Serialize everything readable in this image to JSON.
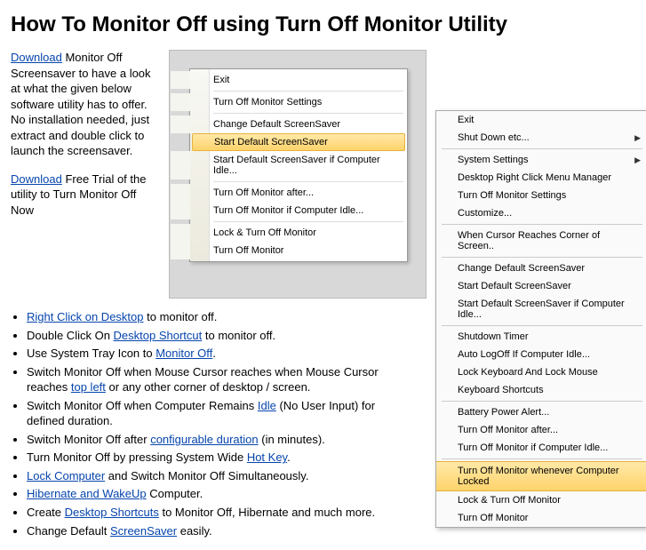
{
  "title": "How To Monitor Off using Turn Off Monitor Utility",
  "intro": {
    "link1": "Download",
    "p1": " Monitor Off Screensaver to have a look at what the given below software utility has to offer. No installation needed, just extract and double click to launch the screensaver.",
    "link2": "Download",
    "p2": " Free Trial of the utility to Turn Monitor Off Now"
  },
  "menu1": [
    {
      "label": "Exit"
    },
    {
      "sep": true
    },
    {
      "label": "Turn Off Monitor Settings"
    },
    {
      "sep": true
    },
    {
      "label": "Change Default ScreenSaver"
    },
    {
      "label": "Start Default ScreenSaver",
      "hl": true
    },
    {
      "label": "Start Default ScreenSaver if Computer Idle..."
    },
    {
      "sep": true
    },
    {
      "label": "Turn Off Monitor after..."
    },
    {
      "label": "Turn Off Monitor if Computer Idle..."
    },
    {
      "sep": true
    },
    {
      "label": "Lock & Turn Off Monitor"
    },
    {
      "label": "Turn Off Monitor"
    }
  ],
  "menu2": [
    {
      "label": "Exit"
    },
    {
      "label": "Shut Down etc...",
      "sub": true
    },
    {
      "sep": true
    },
    {
      "label": "System Settings",
      "sub": true
    },
    {
      "label": "Desktop Right Click Menu Manager"
    },
    {
      "label": "Turn Off Monitor Settings"
    },
    {
      "label": "Customize..."
    },
    {
      "sep": true
    },
    {
      "label": "When Cursor Reaches Corner of Screen.."
    },
    {
      "sep": true
    },
    {
      "label": "Change Default ScreenSaver"
    },
    {
      "label": "Start Default ScreenSaver"
    },
    {
      "label": "Start Default ScreenSaver if Computer Idle..."
    },
    {
      "sep": true
    },
    {
      "label": "Shutdown Timer"
    },
    {
      "label": "Auto LogOff If Computer Idle..."
    },
    {
      "label": "Lock Keyboard And Lock Mouse"
    },
    {
      "label": "Keyboard Shortcuts"
    },
    {
      "sep": true
    },
    {
      "label": "Battery Power Alert..."
    },
    {
      "label": "Turn Off Monitor after..."
    },
    {
      "label": "Turn Off Monitor if Computer Idle..."
    },
    {
      "sep": true
    },
    {
      "label": "Turn Off Monitor whenever Computer Locked",
      "hl": true
    },
    {
      "label": "Lock & Turn Off Monitor"
    },
    {
      "label": "Turn Off Monitor"
    }
  ],
  "bullets": {
    "b1a": "Right Click on Desktop",
    "b1b": " to monitor off.",
    "b2a": "Double Click On ",
    "b2b": "Desktop Shortcut",
    "b2c": " to monitor off.",
    "b3a": "Use System Tray Icon to ",
    "b3b": "Monitor Off",
    "b3c": ".",
    "b4a": "Switch Monitor Off when Mouse Cursor reaches when Mouse Cursor reaches ",
    "b4b": "top left",
    "b4c": " or any other corner of desktop / screen.",
    "b5a": "Switch Monitor Off when Computer Remains ",
    "b5b": "Idle",
    "b5c": " (No User Input) for defined duration.",
    "b6a": "Switch Monitor Off after ",
    "b6b": "configurable duration",
    "b6c": " (in minutes).",
    "b7a": "Turn Monitor Off by pressing System Wide ",
    "b7b": "Hot Key",
    "b7c": ".",
    "b8a": "Lock Computer",
    "b8b": " and Switch Monitor Off Simultaneously.",
    "b9a": "Hibernate and WakeUp",
    "b9b": " Computer.",
    "b10a": "Create ",
    "b10b": "Desktop Shortcuts",
    "b10c": " to Monitor Off, Hibernate and much more.",
    "b11a": "Change Default ",
    "b11b": "ScreenSaver",
    "b11c": " easily."
  }
}
